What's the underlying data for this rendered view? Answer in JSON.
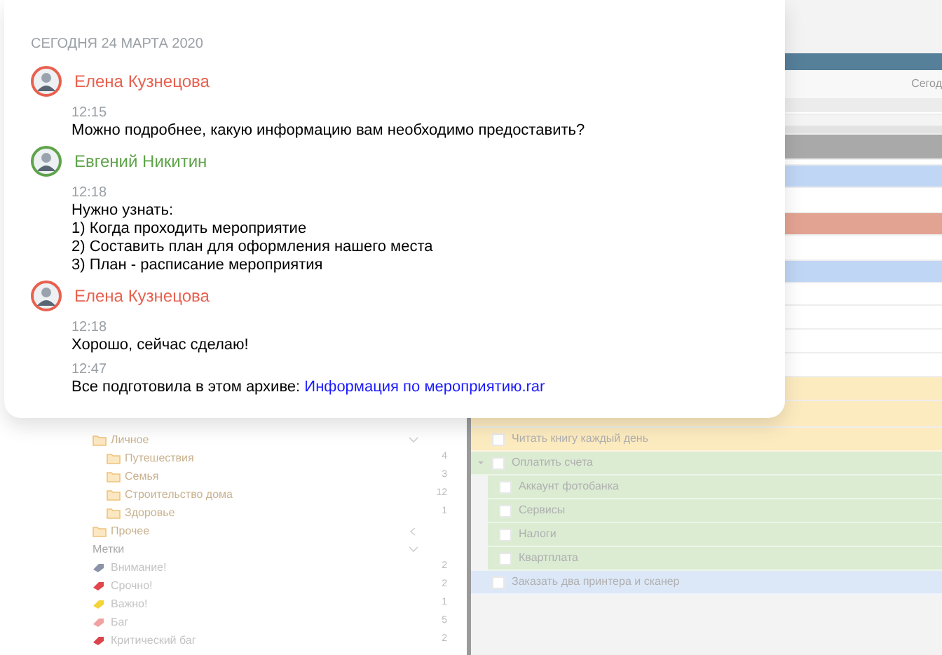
{
  "chat": {
    "date": "СЕГОДНЯ 24 МАРТА 2020",
    "messages": [
      {
        "author": "Елена Кузнецова",
        "color": "#e8614f",
        "entries": [
          {
            "time": "12:15",
            "lines": [
              "Можно подробнее, какую информацию вам необходимо предоставить?"
            ]
          }
        ]
      },
      {
        "author": "Евгений Никитин",
        "color": "#5fa34a",
        "entries": [
          {
            "time": "12:18",
            "lines": [
              "Нужно узнать:",
              "1) Когда проходить мероприятие",
              "2) Составить план для оформления нашего места",
              "3) План - расписание мероприятия"
            ]
          }
        ]
      },
      {
        "author": "Елена Кузнецова",
        "color": "#e8614f",
        "entries": [
          {
            "time": "12:18",
            "lines": [
              "Хорошо, сейчас сделаю!"
            ]
          },
          {
            "time": "12:47",
            "lines": [
              "Все подготовила в этом архиве: "
            ],
            "link": "Информация по мероприятию.rar"
          }
        ]
      }
    ]
  },
  "toolbar": {
    "label": "Сегод"
  },
  "sidebar": {
    "folders": [
      {
        "name": "Личное",
        "expanded": true,
        "children": [
          {
            "name": "Путешествия",
            "count": "4"
          },
          {
            "name": "Семья",
            "count": "3"
          },
          {
            "name": "Строительство дома",
            "count": "12"
          },
          {
            "name": "Здоровье",
            "count": "1"
          }
        ]
      },
      {
        "name": "Прочее",
        "expanded": false
      }
    ],
    "tags_header": {
      "label": "Метки",
      "expanded": true
    },
    "tags": [
      {
        "name": "Внимание!",
        "count": "2",
        "color": "#8a93a8"
      },
      {
        "name": "Срочно!",
        "count": "2",
        "color": "#e0474c"
      },
      {
        "name": "Важно!",
        "count": "1",
        "color": "#f5d43a"
      },
      {
        "name": "Баг",
        "count": "5",
        "color": "#f2a0a0"
      },
      {
        "name": "Критический баг",
        "count": "2",
        "color": "#d9454a"
      }
    ]
  },
  "tasks": [
    {
      "title": "Читать книгу каждый день",
      "color": "#fdebc0",
      "checked": false
    },
    {
      "title": "Оплатить счета",
      "color": "#dbecd3",
      "checked": false,
      "expanded": true,
      "children": [
        {
          "title": "Аккаунт фотобанка",
          "checked": false
        },
        {
          "title": "Сервисы",
          "checked": false
        },
        {
          "title": "Налоги",
          "checked": false
        },
        {
          "title": "Квартплата",
          "checked": false
        }
      ]
    },
    {
      "title": "Заказать два принтера и сканер",
      "color": "#dce8f8",
      "checked": false
    }
  ]
}
